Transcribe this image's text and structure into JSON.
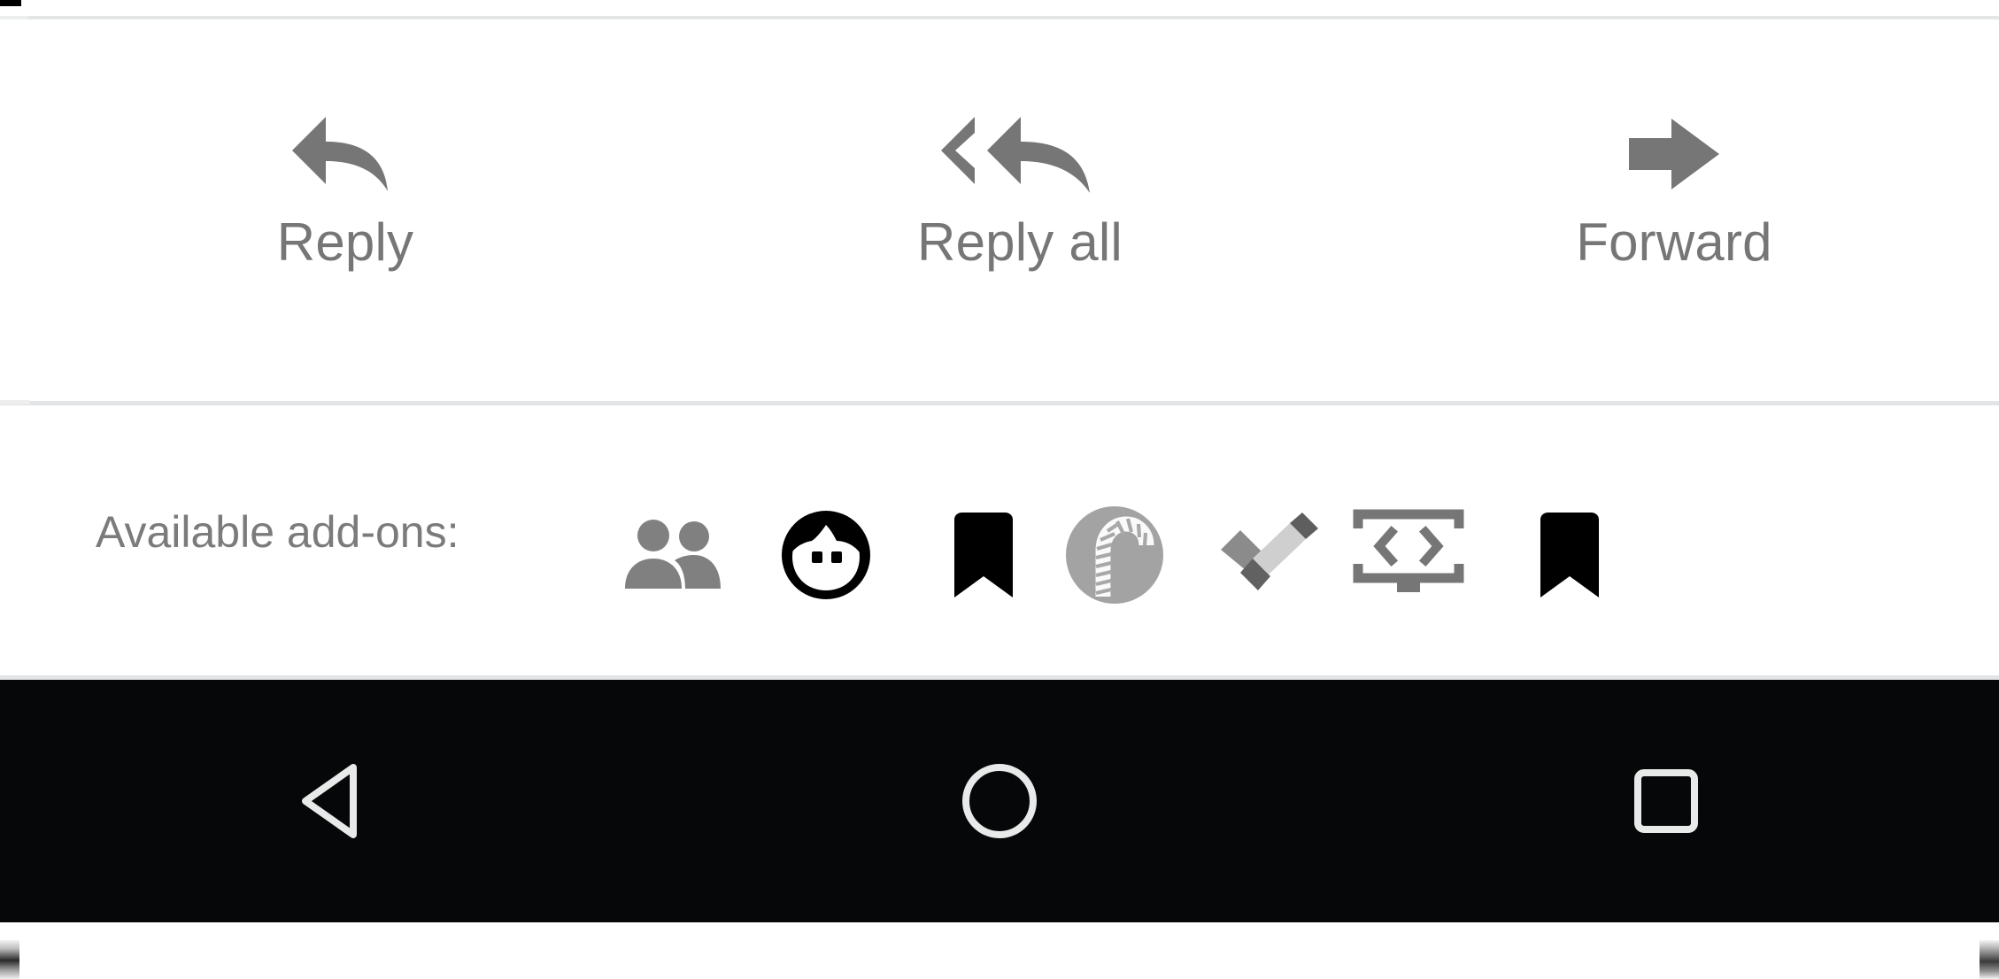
{
  "screen": {
    "app_context": "email-message-actions",
    "background_color": "#ffffff",
    "divider_color": "#e3e4e5",
    "muted_text_color": "#767676",
    "navbar_color": "#050708",
    "navbar_icon_color": "#e8eaea"
  },
  "reply_actions": {
    "items": [
      {
        "id": "reply",
        "label": "Reply",
        "icon": "reply-arrow-icon",
        "icon_color": "#767676"
      },
      {
        "id": "reply_all",
        "label": "Reply all",
        "icon": "reply-all-arrow-icon",
        "icon_color": "#767676"
      },
      {
        "id": "forward",
        "label": "Forward",
        "icon": "forward-arrow-icon",
        "icon_color": "#767676"
      }
    ]
  },
  "addons": {
    "label": "Available add-ons:",
    "label_color": "#7b7b7b",
    "items": [
      {
        "id": "contacts",
        "icon": "people-contacts-icon",
        "color": "#808080"
      },
      {
        "id": "avatar",
        "icon": "face-avatar-icon",
        "color": "#000000"
      },
      {
        "id": "bookmark-1",
        "icon": "bookmark-icon",
        "color": "#000000"
      },
      {
        "id": "candy-cane",
        "icon": "candy-cane-circle-icon",
        "color": "#a3a3a3"
      },
      {
        "id": "tasks",
        "icon": "checkmark-tasks-icon",
        "color": "#707070"
      },
      {
        "id": "code-monitor",
        "icon": "code-monitor-icon",
        "color": "#767676"
      },
      {
        "id": "bookmark-2",
        "icon": "bookmark-icon",
        "color": "#000000"
      }
    ],
    "scroll_edge_left": "partial-icon-stub",
    "scroll_edge_right": "partial-icon-stub"
  },
  "navbar": {
    "buttons": [
      {
        "id": "back",
        "icon": "back-triangle-icon"
      },
      {
        "id": "home",
        "icon": "home-circle-icon"
      },
      {
        "id": "recents",
        "icon": "recents-square-icon"
      }
    ]
  }
}
